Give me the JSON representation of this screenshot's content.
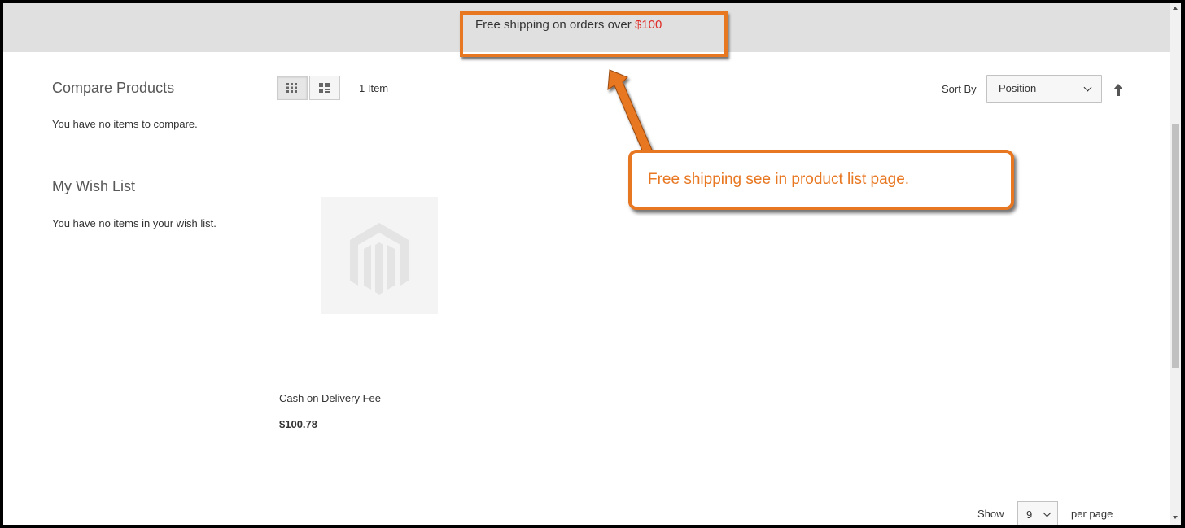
{
  "banner": {
    "text": "Free shipping on orders over ",
    "amount": "$100"
  },
  "sidebar": {
    "compare": {
      "title": "Compare Products",
      "empty_text": "You have no items to compare."
    },
    "wishlist": {
      "title": "My Wish List",
      "empty_text": "You have no items in your wish list."
    }
  },
  "toolbar": {
    "view_modes": [
      {
        "name": "grid",
        "icon": "grid-view-icon",
        "active": true
      },
      {
        "name": "list",
        "icon": "list-view-icon",
        "active": false
      }
    ],
    "amount": "1 Item",
    "sort_label": "Sort By",
    "sort_value": "Position",
    "sort_direction_icon": "arrow-up-icon"
  },
  "product": {
    "name": "Cash on Delivery Fee",
    "price": "$100.78",
    "image_icon": "magento-logo-placeholder"
  },
  "annotation": {
    "text": "Free shipping see in product list page.",
    "color": "#e87722"
  },
  "limiter": {
    "show_label": "Show",
    "value": "9",
    "per_page_label": "per page"
  },
  "colors": {
    "accent": "#e87722",
    "price_highlight": "#e02b27",
    "banner_bg": "#e0e0e0"
  }
}
